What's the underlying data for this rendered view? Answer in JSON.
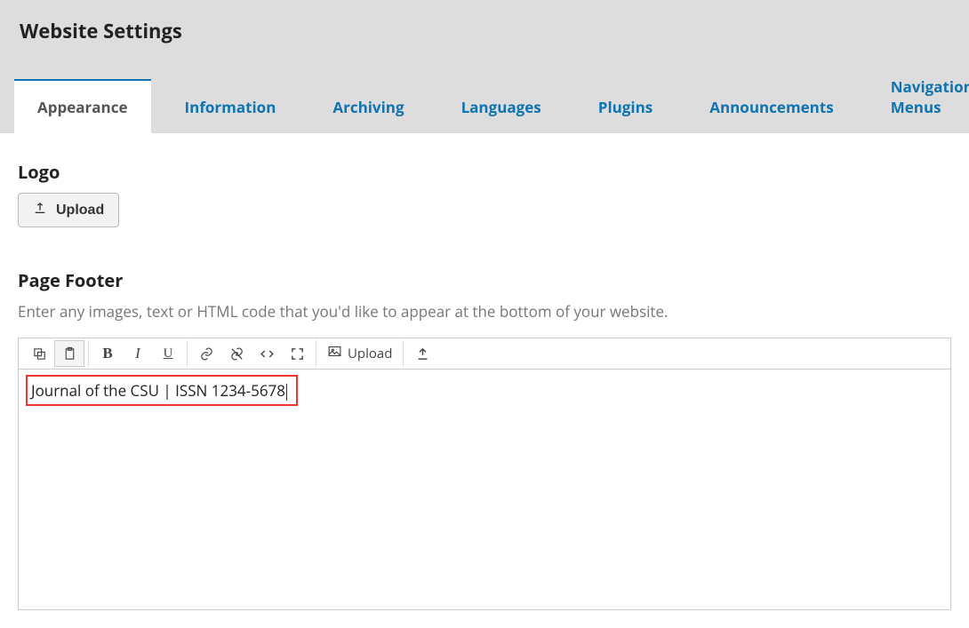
{
  "page_title": "Website Settings",
  "tabs": [
    {
      "label": "Appearance",
      "active": true
    },
    {
      "label": "Information",
      "active": false
    },
    {
      "label": "Archiving",
      "active": false
    },
    {
      "label": "Languages",
      "active": false
    },
    {
      "label": "Plugins",
      "active": false
    },
    {
      "label": "Announcements",
      "active": false
    },
    {
      "label": "Navigation Menus",
      "active": false
    }
  ],
  "logo": {
    "heading": "Logo",
    "upload_label": "Upload"
  },
  "footer": {
    "heading": "Page Footer",
    "help_text": "Enter any images, text or HTML code that you'd like to appear at the bottom of your website.",
    "content": "Journal of the CSU | ISSN 1234-5678"
  },
  "editor_toolbar": {
    "upload_label": "Upload"
  }
}
